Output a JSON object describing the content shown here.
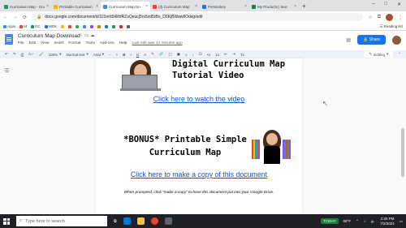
{
  "browser": {
    "tabs": [
      {
        "title": "Curriculum Map - Goo",
        "color": "#0f9d58"
      },
      {
        "title": "Printable Curriculum",
        "color": "#f4b400"
      },
      {
        "title": "Curriculum Map Do",
        "color": "#4285f4",
        "active": true
      },
      {
        "title": "(3) Curriculum Map",
        "color": "#ea4335"
      },
      {
        "title": "PicMonkey",
        "color": "#1a73e8"
      },
      {
        "title": "My Products | teac",
        "color": "#188038"
      }
    ],
    "url": "docs.google.com/document/d/11Snrb5i6lhfRZsQeucj5rs5zd5rBo_D5KjBWaw8Odsg/edit",
    "bookmarks": [
      "Apps",
      "M",
      "GC",
      "WDK",
      "",
      "",
      "",
      "",
      "",
      "",
      "",
      "",
      "",
      ""
    ],
    "reading_list": "Reading list"
  },
  "docs": {
    "title": "Curriculum Map Download",
    "menu": [
      "File",
      "Edit",
      "View",
      "Insert",
      "Format",
      "Tools",
      "Add-ons",
      "Help"
    ],
    "last_edit": "Last edit was 14 minutes ago",
    "share_label": "Share",
    "toolbar": {
      "zoom": "100%",
      "style": "Normal text",
      "font": "Arial",
      "mode": "Editing"
    }
  },
  "content": {
    "heading1": "Digital Curriculum Map Tutorial Video",
    "link1": "Click here to watch the video",
    "heading2": "*BONUS* Printable Simple Curriculum Map",
    "link2": "Click here to make a copy of this document",
    "note": "When prompted, click \"make a copy\" to have this document put into your Google Drive."
  },
  "taskbar": {
    "search_placeholder": "Type here to search",
    "stock": "TCEHY",
    "temp": "69°F",
    "time": "2:30 PM",
    "date": "7/2/2021"
  }
}
